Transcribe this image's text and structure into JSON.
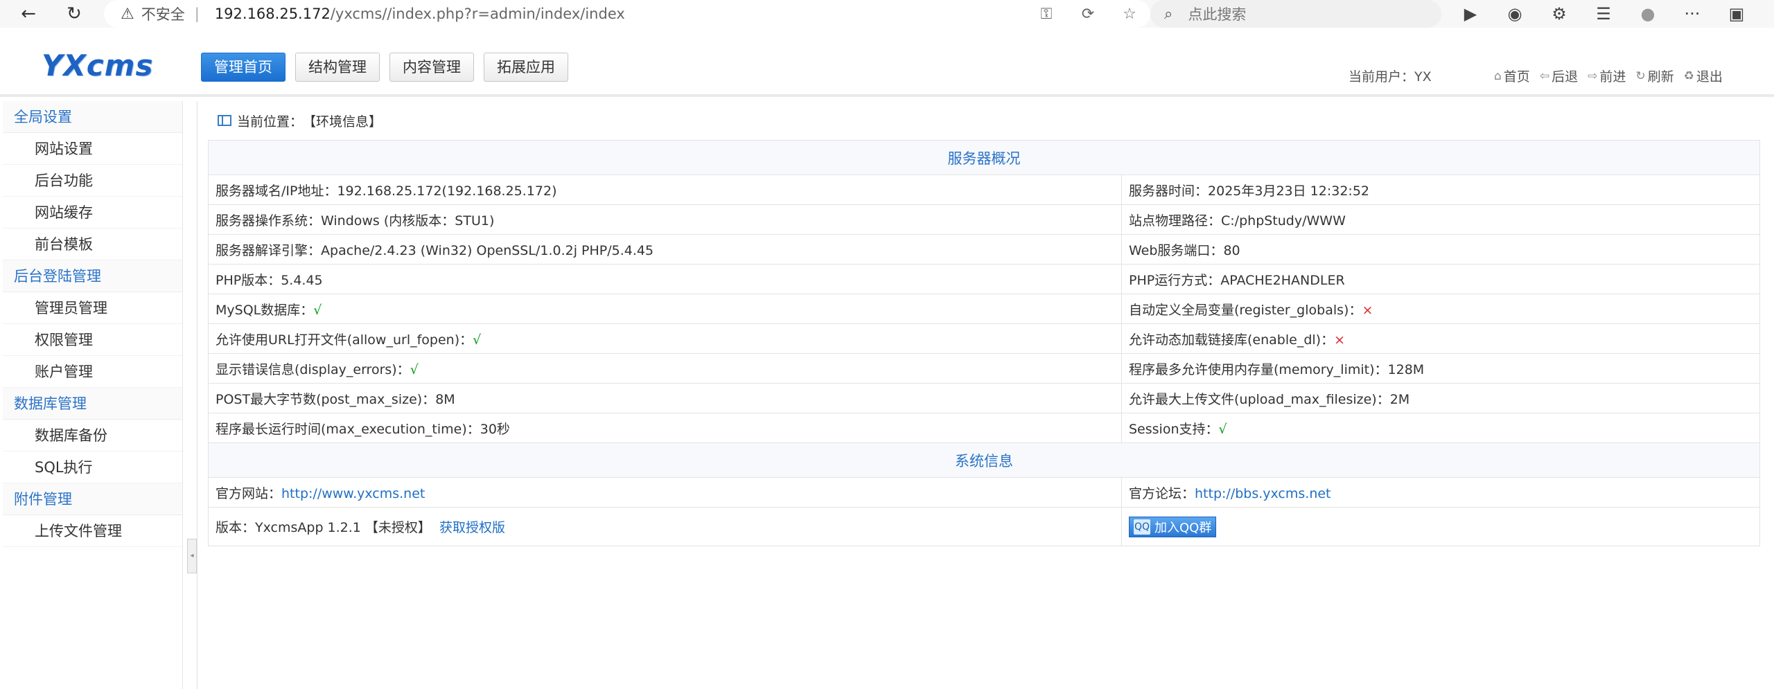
{
  "browser": {
    "back_glyph": "←",
    "refresh_glyph": "↻",
    "warning_glyph": "⚠",
    "insecure_label": "不安全",
    "separator": "|",
    "url_host": "192.168.25.172",
    "url_path": "/yxcms//index.php?r=admin/index/index",
    "search_placeholder": "点此搜索",
    "icons": [
      "key-icon",
      "translate-icon",
      "star-icon",
      "search-icon",
      "play-icon",
      "circle-icon",
      "extensions-icon",
      "favorites-icon",
      "profile-icon",
      "more-icon",
      "collections-icon"
    ],
    "glyphs": {
      "key": "⚿",
      "translate": "⟳",
      "star": "☆",
      "search": "⌕",
      "play": "▶",
      "circle": "◉",
      "extensions": "⚙",
      "favorites": "☰",
      "profile": "●",
      "more": "···",
      "collections": "▣"
    }
  },
  "header": {
    "logo": "YXcms",
    "tabs": [
      "管理首页",
      "结构管理",
      "内容管理",
      "拓展应用"
    ],
    "current_user_label": "当前用户：",
    "current_user": "YX",
    "quick_links": [
      {
        "glyph": "⌂",
        "label": "首页"
      },
      {
        "glyph": "⇦",
        "label": "后退"
      },
      {
        "glyph": "⇨",
        "label": "前进"
      },
      {
        "glyph": "↻",
        "label": "刷新"
      },
      {
        "glyph": "♻",
        "label": "退出"
      }
    ]
  },
  "sidebar": {
    "groups": [
      {
        "title": "全局设置",
        "items": [
          "网站设置",
          "后台功能",
          "网站缓存",
          "前台模板"
        ]
      },
      {
        "title": "后台登陆管理",
        "items": [
          "管理员管理",
          "权限管理",
          "账户管理"
        ]
      },
      {
        "title": "数据库管理",
        "items": [
          "数据库备份",
          "SQL执行"
        ]
      },
      {
        "title": "附件管理",
        "items": [
          "上传文件管理"
        ]
      }
    ],
    "toggle_glyph": "◂"
  },
  "breadcrumb": {
    "label": "当前位置：",
    "value": "【环境信息】"
  },
  "server": {
    "title": "服务器概况",
    "rows": [
      [
        {
          "label": "服务器域名/IP地址：",
          "value": "192.168.25.172(192.168.25.172)"
        },
        {
          "label": "服务器时间：",
          "value": "2025年3月23日 12:32:52"
        }
      ],
      [
        {
          "label": "服务器操作系统：",
          "value": "Windows (内核版本：STU1)"
        },
        {
          "label": "站点物理路径：",
          "value": "C:/phpStudy/WWW"
        }
      ],
      [
        {
          "label": "服务器解译引擎：",
          "value": "Apache/2.4.23 (Win32) OpenSSL/1.0.2j PHP/5.4.45"
        },
        {
          "label": "Web服务端口：",
          "value": "80"
        }
      ],
      [
        {
          "label": "PHP版本：",
          "value": "5.4.45"
        },
        {
          "label": "PHP运行方式：",
          "value": "APACHE2HANDLER"
        }
      ],
      [
        {
          "label": "MySQL数据库：",
          "value": "√",
          "mark": "check"
        },
        {
          "label": "自动定义全局变量(register_globals)：",
          "value": "×",
          "mark": "cross"
        }
      ],
      [
        {
          "label": "允许使用URL打开文件(allow_url_fopen)：",
          "value": "√",
          "mark": "check"
        },
        {
          "label": "允许动态加载链接库(enable_dl)：",
          "value": "×",
          "mark": "cross"
        }
      ],
      [
        {
          "label": "显示错误信息(display_errors)：",
          "value": "√",
          "mark": "check"
        },
        {
          "label": "程序最多允许使用内存量(memory_limit)：",
          "value": "128M"
        }
      ],
      [
        {
          "label": "POST最大字节数(post_max_size)：",
          "value": "8M"
        },
        {
          "label": "允许最大上传文件(upload_max_filesize)：",
          "value": "2M"
        }
      ],
      [
        {
          "label": "程序最长运行时间(max_execution_time)：",
          "value": "30秒"
        },
        {
          "label": "Session支持：",
          "value": "√",
          "mark": "check"
        }
      ]
    ]
  },
  "system": {
    "title": "系统信息",
    "site_label": "官方网站：",
    "site_url": "http://www.yxcms.net",
    "forum_label": "官方论坛：",
    "forum_url": "http://bbs.yxcms.net",
    "version_label": "版本：",
    "version": "YxcmsApp 1.2.1 【未授权】",
    "get_license": "获取授权版",
    "qq_button": "加入QQ群",
    "qq_glyph": "QQ"
  },
  "colors": {
    "accent": "#2a73c8",
    "check": "#0a9e1d",
    "cross": "#e0262e",
    "active_tab": "#1a6fd0"
  }
}
